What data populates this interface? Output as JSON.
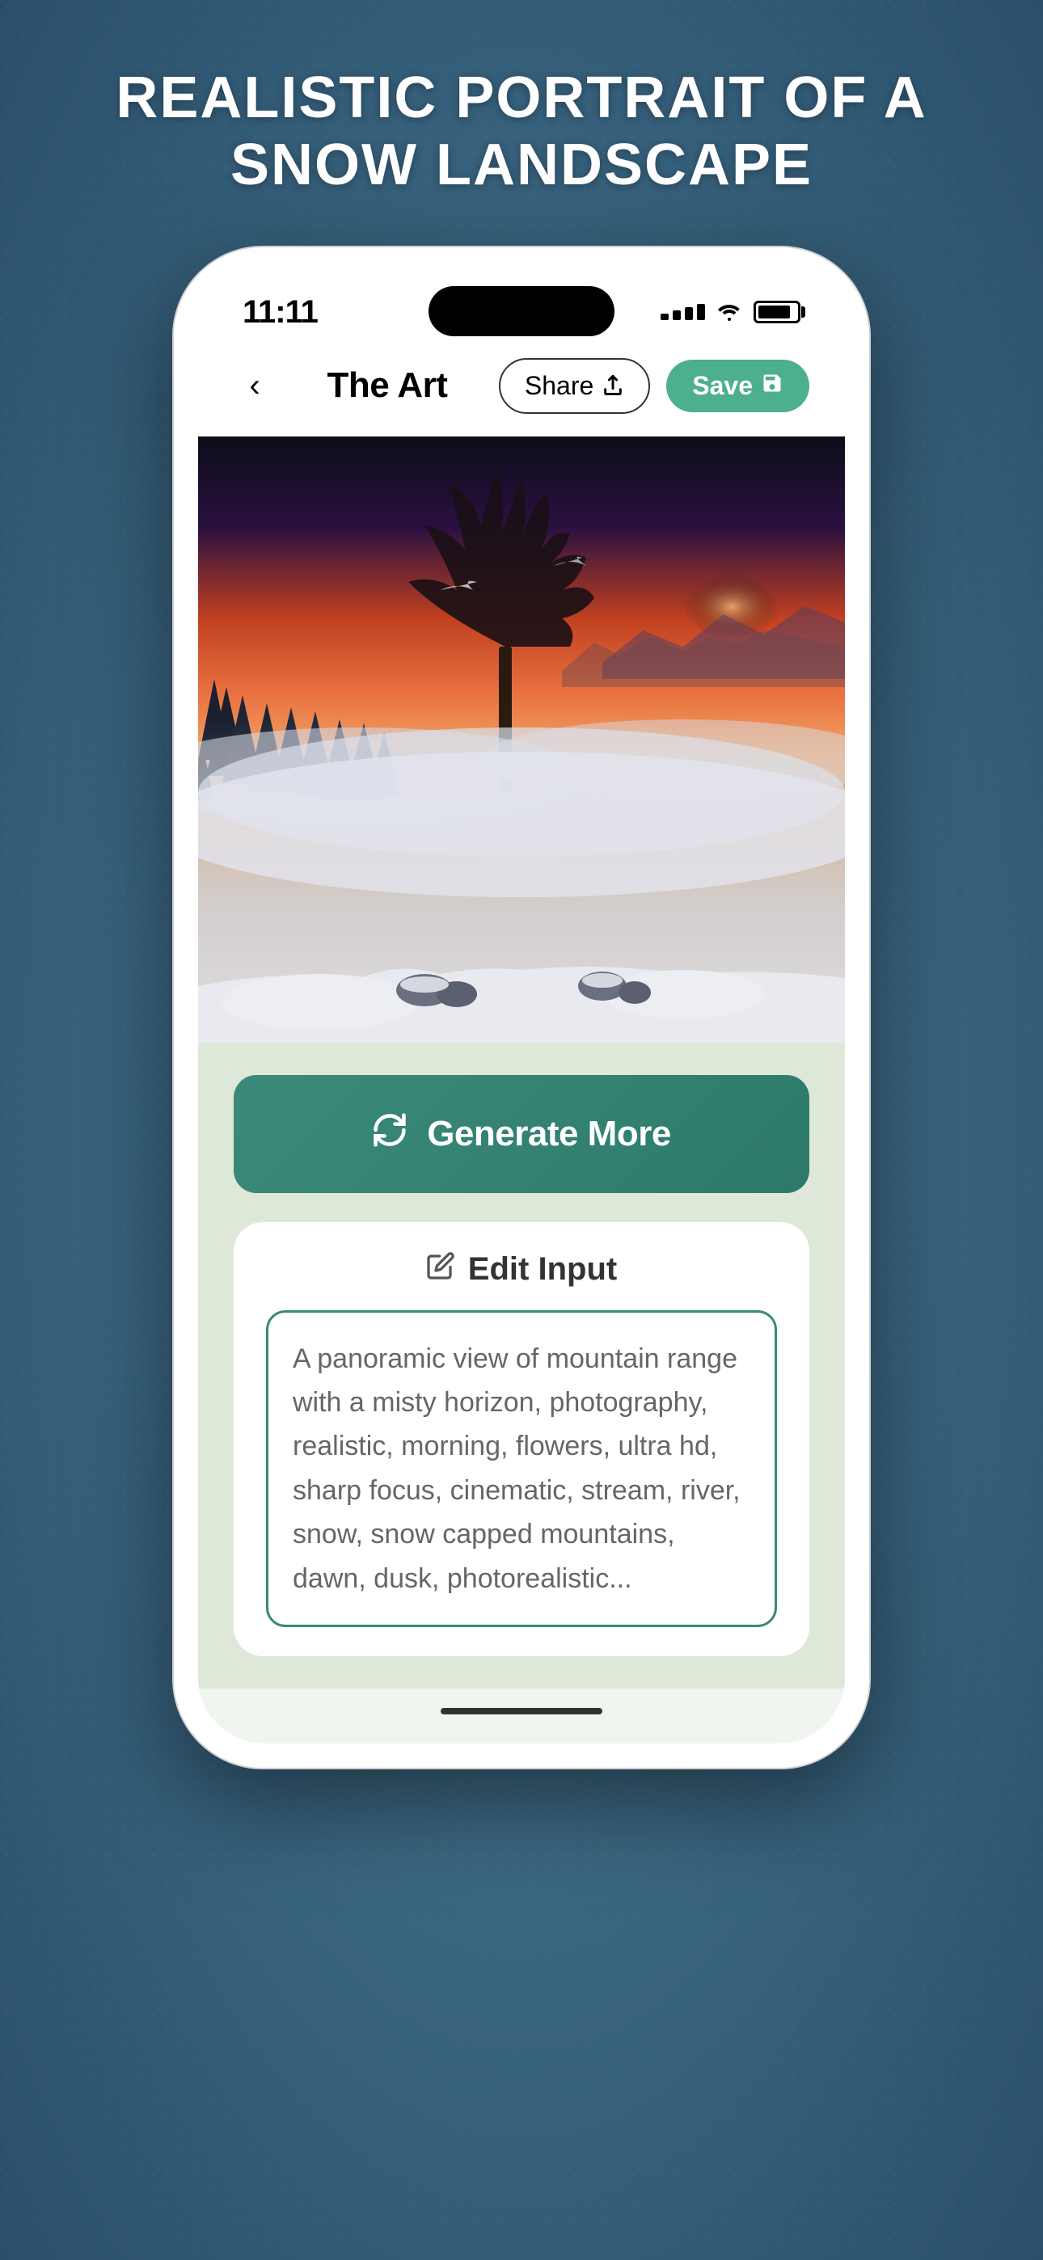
{
  "page": {
    "title_line1": "REALISTIC PORTRAIT OF A",
    "title_line2": "SNOW LANDSCAPE"
  },
  "statusBar": {
    "time": "11:11",
    "wifi_label": "wifi",
    "battery_label": "battery"
  },
  "navBar": {
    "title": "The Art",
    "share_label": "Share",
    "save_label": "Save"
  },
  "generateButton": {
    "label": "Generate More"
  },
  "editInput": {
    "header_label": "Edit Input",
    "placeholder_text": "A panoramic view of mountain range with a misty horizon, photography, realistic, morning, flowers, ultra hd, sharp focus, cinematic, stream, river, snow, snow capped mountains, dawn, dusk, photorealistic..."
  },
  "colors": {
    "teal_accent": "#4caf8e",
    "dark_teal": "#2d7a6a",
    "bg_green": "#dde8d8",
    "generate_bg": "#3a8a7a"
  }
}
